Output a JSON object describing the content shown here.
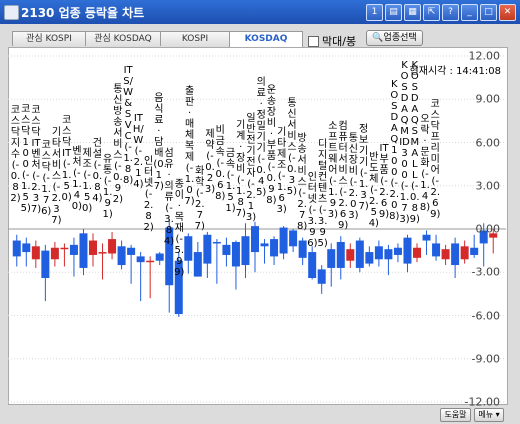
{
  "window": {
    "title": "2130 업종 등락율 차트",
    "buttons": [
      "1",
      "?",
      "?",
      "?",
      "?",
      "_",
      "□",
      "X"
    ]
  },
  "tabs": [
    {
      "label": "관심 KOSPI",
      "active": false
    },
    {
      "label": "관심 KOSDAQ",
      "active": false
    },
    {
      "label": "KOSPI",
      "active": false
    },
    {
      "label": "KOSDAQ",
      "active": true
    }
  ],
  "compare": {
    "label": "막대/봉",
    "checked": false
  },
  "sector_button": {
    "label": "업종선택"
  },
  "clock": {
    "label": "현재시각",
    "time": "14:41:08",
    "display": "현재시각 : 14:41:08"
  },
  "colors": {
    "up": "#d42a2a",
    "down": "#1f5fe0",
    "accent": "#2a62c8"
  },
  "chart_data": {
    "type": "bar",
    "ylim": [
      -12,
      12
    ],
    "yticks": [
      "12.00",
      "9.00",
      "6.00",
      "3.00",
      "0.00",
      "-3.00",
      "-6.00",
      "-9.00",
      "-12.00"
    ],
    "categories": [
      "코스닥지수(-0.82)",
      "코스닥100(-1.55)",
      "코스닥IT벤처(-2.37)",
      "코스닥(-1.76)",
      "기타서비스(-2.37)",
      "코스닥IT(-1.50)",
      "벤처(-1.40)",
      "제조(-1.50)",
      "건설(-0.84)",
      "유통(-1.91)",
      "통신방송서비스(-0.92)",
      "IT S/W&SVC(-1.88)",
      "IT H/W(-2.14)",
      "인터넷(-2.82)",
      "음식료·담배(0.17)",
      "섬유·의류(-3.84)",
      "종이·목재(-5.99)",
      "출판·매체복제(-1.07)",
      "화학(-2.77)",
      "제약(-0.23)",
      "비금속(-0.68)",
      "금속(-1.51)",
      "기계·장비(-1.87)",
      "일반전기전자(-2.13)",
      "의료·정밀기기(-0.45)",
      "운송장비·부품(-0.98)",
      "기타제조(-1.63)",
      "통신서비스(-0.35)",
      "방송서비스(-2.78)",
      "인터넷(-3.96)",
      "디지털컨텐츠(-3.95)",
      "소프트웨어(-1.93)",
      "컴퓨터서비스(-2.69)",
      "통신장비(-2.03)",
      "정보기기(-1.37)",
      "반도체(-2.54)",
      "IT부품(-2.69)",
      "KOSDAQ100(-2.08)",
      "KOSDAQMID300(-1.73)",
      "KOSDAQSMALL(-0.89)",
      "오락·문화(-1.48)",
      "코스닥 프리미어(-2.69)"
    ],
    "values": [
      -0.82,
      -1.55,
      -2.37,
      -1.76,
      -2.37,
      -1.5,
      -1.4,
      -1.5,
      -0.84,
      -1.91,
      -0.92,
      -1.88,
      -2.14,
      -2.82,
      0.17,
      -3.84,
      -5.99,
      -1.07,
      -2.77,
      -0.23,
      -0.68,
      -1.51,
      -1.87,
      -2.13,
      -0.45,
      -0.98,
      -1.63,
      -0.35,
      -2.78,
      -3.96,
      -3.95,
      -1.93,
      -2.69,
      -2.03,
      -1.37,
      -2.54,
      -2.69,
      -2.08,
      -1.73,
      -0.89,
      -1.48,
      -2.69
    ],
    "bars": [
      {
        "open": -0.8,
        "close": -1.9,
        "high": -0.4,
        "low": -2.6
      },
      {
        "open": -1.0,
        "close": -1.6,
        "high": -0.6,
        "low": -2.6
      },
      {
        "open": -2.1,
        "close": -1.2,
        "high": -0.8,
        "low": -2.7
      },
      {
        "open": -1.5,
        "close": -3.4,
        "high": -1.1,
        "low": -5.0
      },
      {
        "open": -2.1,
        "close": -1.3,
        "high": -0.9,
        "low": -2.6
      },
      {
        "open": -1.3,
        "close": -1.3,
        "high": -1.0,
        "low": -2.6
      },
      {
        "open": -1.1,
        "close": -1.8,
        "high": -0.6,
        "low": -3.3
      },
      {
        "open": -0.3,
        "close": -2.7,
        "high": 0.0,
        "low": -3.2
      },
      {
        "open": -1.8,
        "close": -0.8,
        "high": -0.3,
        "low": -2.6
      },
      {
        "open": -1.6,
        "close": -1.6,
        "high": -1.0,
        "low": -3.5
      },
      {
        "open": -1.7,
        "close": -0.7,
        "high": -0.2,
        "low": -2.1
      },
      {
        "open": -1.2,
        "close": -2.5,
        "high": -0.8,
        "low": -2.8
      },
      {
        "open": -1.3,
        "close": -1.8,
        "high": -1.1,
        "low": -3.8
      },
      {
        "open": -1.9,
        "close": -2.3,
        "high": -1.6,
        "low": -5.0
      },
      {
        "open": -2.2,
        "close": -2.2,
        "high": -1.9,
        "low": -4.8
      },
      {
        "open": -1.7,
        "close": -2.2,
        "high": -1.6,
        "low": -2.5
      },
      {
        "open": 0.1,
        "close": -3.9,
        "high": 0.7,
        "low": -5.8
      },
      {
        "open": -2.2,
        "close": -5.9,
        "high": -1.6,
        "low": -6.1
      },
      {
        "open": -0.5,
        "close": -2.2,
        "high": -0.3,
        "low": -3.1
      },
      {
        "open": -1.6,
        "close": -3.3,
        "high": -0.9,
        "low": -3.3
      },
      {
        "open": -0.4,
        "close": -2.4,
        "high": -0.2,
        "low": -3.4
      },
      {
        "open": -0.9,
        "close": -1.0,
        "high": -0.7,
        "low": -3.8
      },
      {
        "open": -1.1,
        "close": -1.8,
        "high": -0.6,
        "low": -2.6
      },
      {
        "open": -0.9,
        "close": -2.6,
        "high": -0.8,
        "low": -4.2
      },
      {
        "open": -0.5,
        "close": -2.5,
        "high": 0.4,
        "low": -3.4
      },
      {
        "open": 0.2,
        "close": -1.6,
        "high": 0.5,
        "low": -3.0
      },
      {
        "open": -1.0,
        "close": -1.2,
        "high": -0.7,
        "low": -2.4
      },
      {
        "open": -0.7,
        "close": -1.9,
        "high": -0.5,
        "low": -2.5
      },
      {
        "open": 0.1,
        "close": -1.7,
        "high": 0.2,
        "low": -2.1
      },
      {
        "open": -0.1,
        "close": -1.2,
        "high": 0.0,
        "low": -1.6
      },
      {
        "open": -0.8,
        "close": -2.0,
        "high": -0.6,
        "low": -2.5
      },
      {
        "open": -1.6,
        "close": -3.4,
        "high": -1.2,
        "low": -3.5
      },
      {
        "open": -2.8,
        "close": -3.8,
        "high": -2.5,
        "low": -4.5
      },
      {
        "open": -1.4,
        "close": -2.7,
        "high": -1.0,
        "low": -4.0
      },
      {
        "open": -0.9,
        "close": -2.7,
        "high": -0.5,
        "low": -3.5
      },
      {
        "open": -2.2,
        "close": -1.4,
        "high": -1.0,
        "low": -2.7
      },
      {
        "open": -0.8,
        "close": -2.7,
        "high": -0.6,
        "low": -3.0
      },
      {
        "open": -1.6,
        "close": -2.4,
        "high": -1.2,
        "low": -2.6
      },
      {
        "open": -1.2,
        "close": -2.1,
        "high": -0.8,
        "low": -2.6
      },
      {
        "open": -1.4,
        "close": -2.1,
        "high": -1.1,
        "low": -3.2
      },
      {
        "open": -1.3,
        "close": -1.8,
        "high": -1.0,
        "low": -2.3
      },
      {
        "open": -0.6,
        "close": -2.4,
        "high": -0.4,
        "low": -3.0
      },
      {
        "open": -2.0,
        "close": -1.3,
        "high": -1.0,
        "low": -2.3
      },
      {
        "open": -0.4,
        "close": -0.8,
        "high": -0.1,
        "low": -1.8
      },
      {
        "open": -1.0,
        "close": -1.9,
        "high": -0.4,
        "low": -2.2
      },
      {
        "open": -2.1,
        "close": -1.4,
        "high": -1.1,
        "low": -2.5
      },
      {
        "open": -1.0,
        "close": -2.5,
        "high": -0.6,
        "low": -3.4
      },
      {
        "open": -2.1,
        "close": -1.2,
        "high": -0.8,
        "low": -2.4
      },
      {
        "open": -1.3,
        "close": -1.8,
        "high": -0.4,
        "low": -2.0
      },
      {
        "open": -0.1,
        "close": -1.0,
        "high": 0.4,
        "low": -2.6
      },
      {
        "open": -0.6,
        "close": -0.3,
        "high": 0.0,
        "low": -1.7
      }
    ],
    "grid": true
  },
  "bottom": {
    "help_label": "도움말",
    "menu_label": "메뉴 ▾"
  }
}
